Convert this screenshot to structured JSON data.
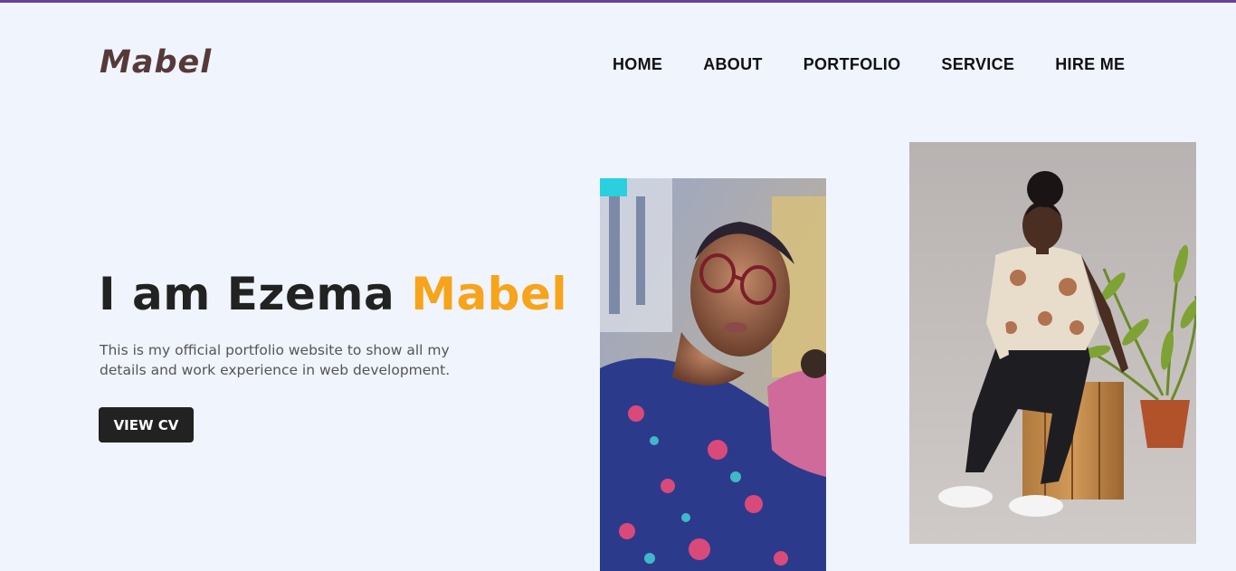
{
  "brand": {
    "logo": "Mabel"
  },
  "nav": {
    "items": [
      {
        "label": "HOME"
      },
      {
        "label": "ABOUT"
      },
      {
        "label": "PORTFOLIO"
      },
      {
        "label": "SERVICE"
      },
      {
        "label": "HIRE ME"
      }
    ]
  },
  "hero": {
    "title_prefix": "I am Ezema ",
    "title_accent": "Mabel",
    "description": "This is my official portfolio website to show all my details and work experience in web development.",
    "cta_label": "VIEW CV"
  },
  "colors": {
    "background": "#f0f4fc",
    "top_border": "#6a3fa0",
    "accent": "#f7a41a",
    "logo": "#563a3a",
    "button": "#222222"
  }
}
